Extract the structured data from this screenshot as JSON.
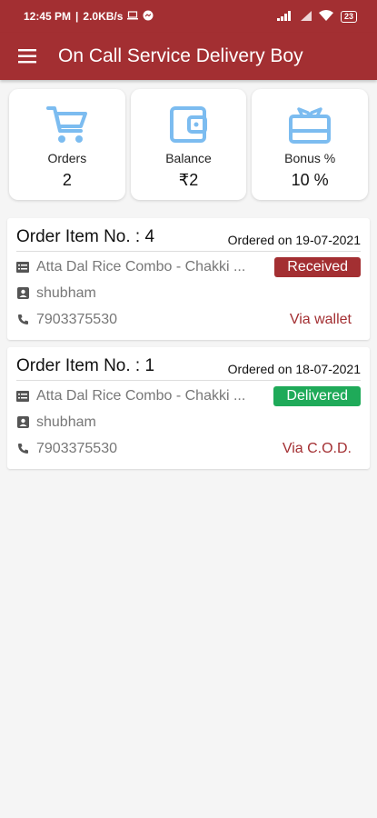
{
  "status_bar": {
    "time": "12:45 PM",
    "speed": "2.0KB/s",
    "battery": "23"
  },
  "app_bar": {
    "title": "On Call Service Delivery Boy",
    "menu_icon": "hamburger-menu-icon"
  },
  "stats": [
    {
      "icon": "cart-icon",
      "label": "Orders",
      "value": "2"
    },
    {
      "icon": "wallet-icon",
      "label": "Balance",
      "value": "₹2"
    },
    {
      "icon": "gift-card-icon",
      "label": "Bonus %",
      "value": "10 %"
    }
  ],
  "orders": [
    {
      "title": "Order Item No. : 4",
      "date": "Ordered on 19-07-2021",
      "item": "Atta Dal Rice Combo - Chakki ...",
      "status": "Received",
      "status_color": "#a32f32",
      "customer": "shubham",
      "phone": "7903375530",
      "payment": "Via wallet"
    },
    {
      "title": "Order Item No. : 1",
      "date": "Ordered on 18-07-2021",
      "item": "Atta Dal Rice Combo - Chakki ...",
      "status": "Delivered",
      "status_color": "#1faa59",
      "customer": "shubham",
      "phone": "7903375530",
      "payment": "Via C.O.D."
    }
  ],
  "colors": {
    "primary": "#a32f32",
    "icon_blue": "#7cbcf0"
  }
}
